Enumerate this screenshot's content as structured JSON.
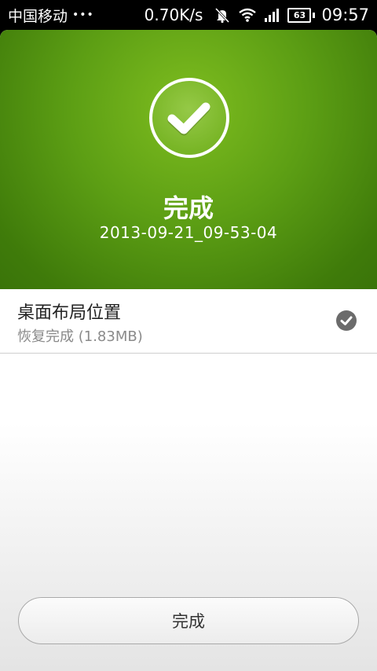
{
  "status_bar": {
    "carrier": "中国移动",
    "dots": "•••",
    "speed": "0.70K/s",
    "battery": "63",
    "time": "09:57",
    "icons": [
      "mute-icon",
      "wifi-icon",
      "signal-icon",
      "battery-icon"
    ]
  },
  "header": {
    "title": "完成",
    "subtitle": "2013-09-21_09-53-04",
    "icon": "check-circle-icon"
  },
  "items": [
    {
      "title": "桌面布局位置",
      "subtitle": "恢复完成 (1.83MB)",
      "icon": "check-badge-icon"
    }
  ],
  "footer": {
    "done_label": "完成"
  },
  "colors": {
    "header_green": "#5c9e14",
    "header_green_dark": "#3a7409",
    "check_badge": "#6b6b6b"
  }
}
